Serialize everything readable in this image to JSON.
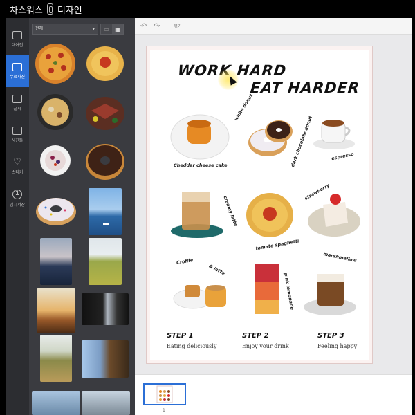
{
  "window": {
    "title_left": "차스워스",
    "title_right": "디자인"
  },
  "rail": [
    {
      "label": "대여진",
      "icon": "image-icon"
    },
    {
      "label": "무료사진",
      "icon": "photo-icon",
      "active": true
    },
    {
      "label": "글씨",
      "icon": "text-icon"
    },
    {
      "label": "사진틀",
      "icon": "frame-icon"
    },
    {
      "label": "스티커",
      "icon": "heart-icon"
    },
    {
      "label": "임시저장",
      "icon": "save-icon"
    }
  ],
  "panel": {
    "select_value": "전체"
  },
  "toolbar": {
    "undo": "↶",
    "redo": "↷",
    "group_label": "묶기"
  },
  "poster": {
    "headline_1": "WORK HARD",
    "headline_2": "EAT HARDER",
    "labels": {
      "cheddar": "Cheddar cheese cake",
      "white_donut": "white donut",
      "dark_choc": "dark chocolate donut",
      "espresso": "espresso",
      "creamy_latte": "creamy latte",
      "tomato": "tomato spaghetti",
      "strawberry": "strawberry",
      "croffle": "Croffle",
      "and_latte": "& latte",
      "pink_lemonade": "pink lemonade",
      "marshmallow": "marshmallow"
    },
    "steps": [
      {
        "title": "STEP 1",
        "sub": "Eating deliciously"
      },
      {
        "title": "STEP 2",
        "sub": "Enjoy your drink"
      },
      {
        "title": "STEP 3",
        "sub": "Feeling happy"
      }
    ]
  },
  "thumbstrip": {
    "page_number": "1"
  }
}
